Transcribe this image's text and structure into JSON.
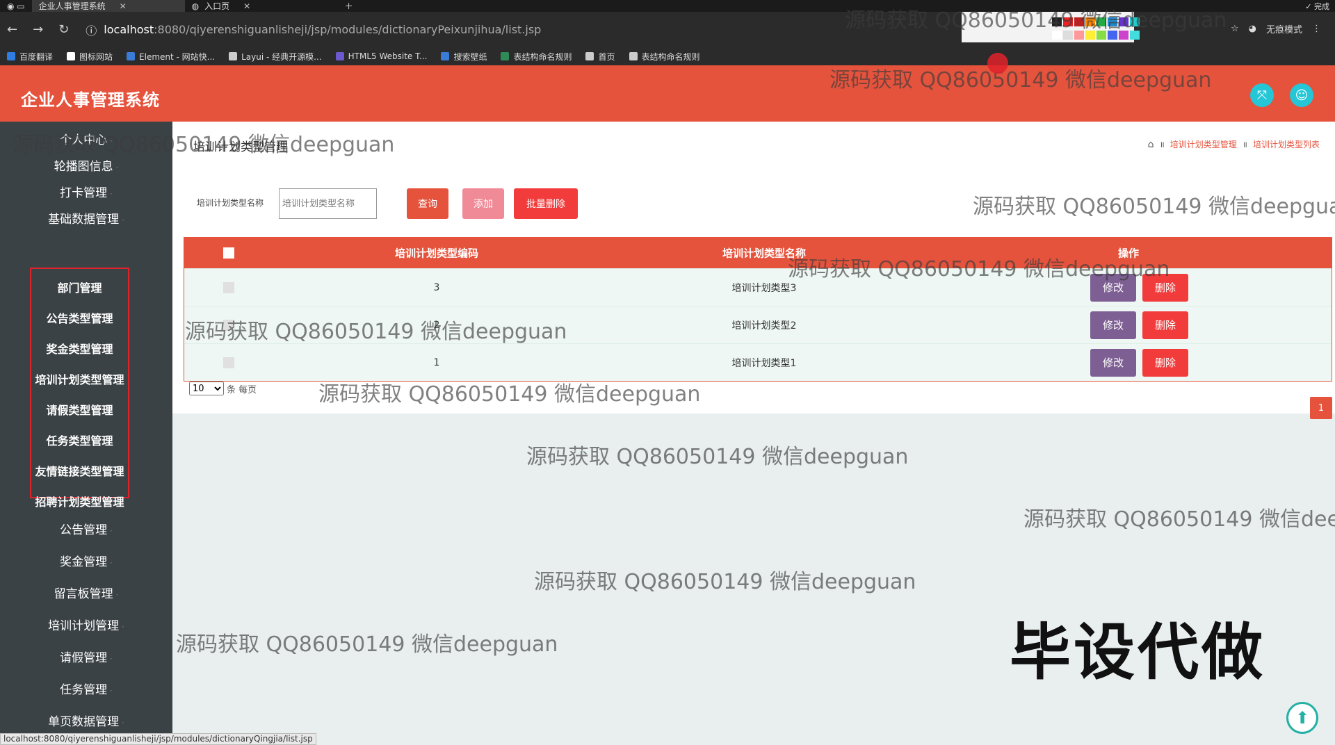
{
  "browser": {
    "tabs": [
      {
        "label": "企业人事管理系统",
        "active": true
      },
      {
        "label": "入口页",
        "active": false
      }
    ],
    "url_host": "localhost",
    "url_path": ":8080/qiyerenshiguanlisheji/jsp/modules/dictionaryPeixunjihua/list.jsp",
    "incognito_label": "无痕模式",
    "done_label": "完成",
    "bookmarks": [
      "百度翻译",
      "图标网站",
      "Element - 网站快...",
      "Layui - 经典开源模...",
      "HTML5 Website T...",
      "搜索壁纸",
      "表结构命名规则",
      "首页",
      "表结构命名规则"
    ],
    "status_url": "localhost:8080/qiyerenshiguanlisheji/jsp/modules/dictionaryQingjia/list.jsp",
    "palette_colors": [
      "#222222",
      "#ee2222",
      "#bb2222",
      "#ff8800",
      "#22aa44",
      "#2288cc",
      "#6633cc",
      "#22cccc",
      "#ffffff",
      "#dddddd",
      "#ff9999",
      "#ffee33",
      "#88dd44",
      "#4466ee",
      "#cc44cc",
      "#44dddd"
    ]
  },
  "app": {
    "title": "企业人事管理系统",
    "header_color": "#e5533d"
  },
  "sidebar": {
    "items_top": [
      "个人中心",
      "轮播图信息",
      "打卡管理",
      "基础数据管理"
    ],
    "sub_items": [
      "部门管理",
      "公告类型管理",
      "奖金类型管理",
      "培训计划类型管理",
      "请假类型管理",
      "任务类型管理",
      "友情链接类型管理",
      "招聘计划类型管理"
    ],
    "items_bottom": [
      "公告管理",
      "奖金管理",
      "留言板管理",
      "培训计划管理",
      "请假管理",
      "任务管理",
      "单页数据管理"
    ]
  },
  "page": {
    "title": "培训计划类型管理",
    "breadcrumb": [
      "培训计划类型管理",
      "培训计划类型列表"
    ],
    "search_label": "培训计划类型名称",
    "search_placeholder": "培训计划类型名称",
    "btn_query": "查询",
    "btn_add": "添加",
    "btn_bulk_delete": "批量删除"
  },
  "table": {
    "headers": {
      "code": "培训计划类型编码",
      "name": "培训计划类型名称",
      "ops": "操作"
    },
    "rows": [
      {
        "code": "3",
        "name": "培训计划类型3"
      },
      {
        "code": "2",
        "name": "培训计划类型2"
      },
      {
        "code": "1",
        "name": "培训计划类型1"
      }
    ],
    "edit_label": "修改",
    "delete_label": "删除"
  },
  "pager": {
    "page_size": "10",
    "page_size_suffix": "条 每页",
    "current_page": "1"
  },
  "overlay": {
    "watermark": "源码获取 QQ86050149 微信deepguan",
    "ad_text": "毕设代做"
  }
}
